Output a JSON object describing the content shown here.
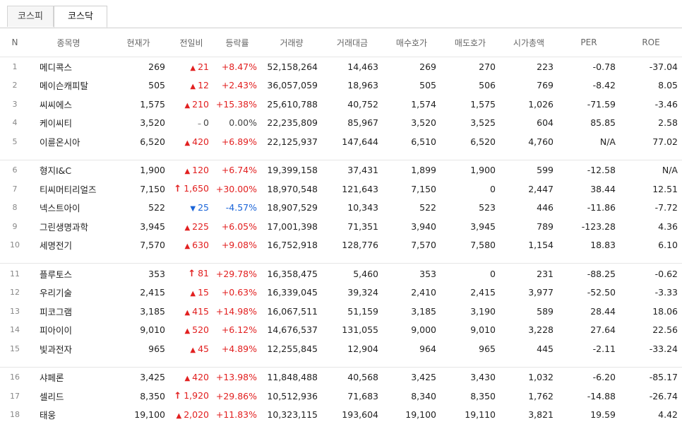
{
  "tabs": [
    {
      "label": "코스피",
      "active": false
    },
    {
      "label": "코스닥",
      "active": true
    }
  ],
  "headers": [
    "N",
    "종목명",
    "현재가",
    "전일비",
    "등락률",
    "거래량",
    "거래대금",
    "매수호가",
    "매도호가",
    "시가총액",
    "PER",
    "ROE"
  ],
  "colors": {
    "up": "#e22020",
    "down": "#1a64d8",
    "flat": "#444444"
  },
  "groups": [
    {
      "rows": [
        {
          "n": "1",
          "name": "메디콕스",
          "price": "269",
          "dir": "up",
          "chg": "21",
          "rate": "+8.47%",
          "vol": "52,158,264",
          "amt": "14,463",
          "bid": "269",
          "ask": "270",
          "cap": "223",
          "per": "-0.78",
          "roe": "-37.04"
        },
        {
          "n": "2",
          "name": "메이슨캐피탈",
          "price": "505",
          "dir": "up",
          "chg": "12",
          "rate": "+2.43%",
          "vol": "36,057,059",
          "amt": "18,963",
          "bid": "505",
          "ask": "506",
          "cap": "769",
          "per": "-8.42",
          "roe": "8.05"
        },
        {
          "n": "3",
          "name": "씨씨에스",
          "price": "1,575",
          "dir": "up",
          "chg": "210",
          "rate": "+15.38%",
          "vol": "25,610,788",
          "amt": "40,752",
          "bid": "1,574",
          "ask": "1,575",
          "cap": "1,026",
          "per": "-71.59",
          "roe": "-3.46"
        },
        {
          "n": "4",
          "name": "케이씨티",
          "price": "3,520",
          "dir": "flat",
          "chg": "0",
          "rate": "0.00%",
          "vol": "22,235,809",
          "amt": "85,967",
          "bid": "3,520",
          "ask": "3,525",
          "cap": "604",
          "per": "85.85",
          "roe": "2.58"
        },
        {
          "n": "5",
          "name": "이륜온시아",
          "price": "6,520",
          "dir": "up",
          "chg": "420",
          "rate": "+6.89%",
          "vol": "22,125,937",
          "amt": "147,644",
          "bid": "6,510",
          "ask": "6,520",
          "cap": "4,760",
          "per": "N/A",
          "roe": "77.02"
        }
      ]
    },
    {
      "rows": [
        {
          "n": "6",
          "name": "형지I&C",
          "price": "1,900",
          "dir": "up",
          "chg": "120",
          "rate": "+6.74%",
          "vol": "19,399,158",
          "amt": "37,431",
          "bid": "1,899",
          "ask": "1,900",
          "cap": "599",
          "per": "-12.58",
          "roe": "N/A"
        },
        {
          "n": "7",
          "name": "티씨머티리얼즈",
          "price": "7,150",
          "dir": "upper",
          "chg": "1,650",
          "rate": "+30.00%",
          "vol": "18,970,548",
          "amt": "121,643",
          "bid": "7,150",
          "ask": "0",
          "cap": "2,447",
          "per": "38.44",
          "roe": "12.51"
        },
        {
          "n": "8",
          "name": "넥스트아이",
          "price": "522",
          "dir": "down",
          "chg": "25",
          "rate": "-4.57%",
          "vol": "18,907,529",
          "amt": "10,343",
          "bid": "522",
          "ask": "523",
          "cap": "446",
          "per": "-11.86",
          "roe": "-7.72"
        },
        {
          "n": "9",
          "name": "그린생명과학",
          "price": "3,945",
          "dir": "up",
          "chg": "225",
          "rate": "+6.05%",
          "vol": "17,001,398",
          "amt": "71,351",
          "bid": "3,940",
          "ask": "3,945",
          "cap": "789",
          "per": "-123.28",
          "roe": "4.36"
        },
        {
          "n": "10",
          "name": "세명전기",
          "price": "7,570",
          "dir": "up",
          "chg": "630",
          "rate": "+9.08%",
          "vol": "16,752,918",
          "amt": "128,776",
          "bid": "7,570",
          "ask": "7,580",
          "cap": "1,154",
          "per": "18.83",
          "roe": "6.10"
        }
      ]
    },
    {
      "rows": [
        {
          "n": "11",
          "name": "플루토스",
          "price": "353",
          "dir": "upper",
          "chg": "81",
          "rate": "+29.78%",
          "vol": "16,358,475",
          "amt": "5,460",
          "bid": "353",
          "ask": "0",
          "cap": "231",
          "per": "-88.25",
          "roe": "-0.62"
        },
        {
          "n": "12",
          "name": "우리기술",
          "price": "2,415",
          "dir": "up",
          "chg": "15",
          "rate": "+0.63%",
          "vol": "16,339,045",
          "amt": "39,324",
          "bid": "2,410",
          "ask": "2,415",
          "cap": "3,977",
          "per": "-52.50",
          "roe": "-3.33"
        },
        {
          "n": "13",
          "name": "피코그램",
          "price": "3,185",
          "dir": "up",
          "chg": "415",
          "rate": "+14.98%",
          "vol": "16,067,511",
          "amt": "51,159",
          "bid": "3,185",
          "ask": "3,190",
          "cap": "589",
          "per": "28.44",
          "roe": "18.06"
        },
        {
          "n": "14",
          "name": "피아이이",
          "price": "9,010",
          "dir": "up",
          "chg": "520",
          "rate": "+6.12%",
          "vol": "14,676,537",
          "amt": "131,055",
          "bid": "9,000",
          "ask": "9,010",
          "cap": "3,228",
          "per": "27.64",
          "roe": "22.56"
        },
        {
          "n": "15",
          "name": "빛과전자",
          "price": "965",
          "dir": "up",
          "chg": "45",
          "rate": "+4.89%",
          "vol": "12,255,845",
          "amt": "12,904",
          "bid": "964",
          "ask": "965",
          "cap": "445",
          "per": "-2.11",
          "roe": "-33.24"
        }
      ]
    },
    {
      "rows": [
        {
          "n": "16",
          "name": "샤페론",
          "price": "3,425",
          "dir": "up",
          "chg": "420",
          "rate": "+13.98%",
          "vol": "11,848,488",
          "amt": "40,568",
          "bid": "3,425",
          "ask": "3,430",
          "cap": "1,032",
          "per": "-6.20",
          "roe": "-85.17"
        },
        {
          "n": "17",
          "name": "셀리드",
          "price": "8,350",
          "dir": "upper",
          "chg": "1,920",
          "rate": "+29.86%",
          "vol": "10,512,936",
          "amt": "71,683",
          "bid": "8,340",
          "ask": "8,350",
          "cap": "1,762",
          "per": "-14.88",
          "roe": "-26.74"
        },
        {
          "n": "18",
          "name": "태웅",
          "price": "19,100",
          "dir": "up",
          "chg": "2,020",
          "rate": "+11.83%",
          "vol": "10,323,115",
          "amt": "193,604",
          "bid": "19,100",
          "ask": "19,110",
          "cap": "3,821",
          "per": "19.59",
          "roe": "4.42"
        }
      ]
    }
  ]
}
